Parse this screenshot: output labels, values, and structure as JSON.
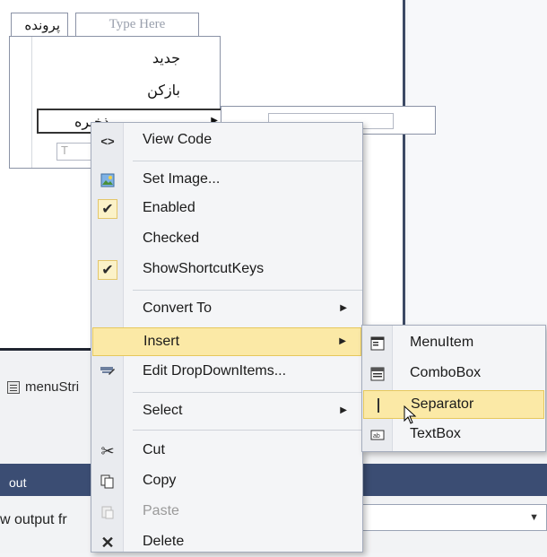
{
  "designer": {
    "menustrip": {
      "file_tab": "پرونده",
      "type_here": "Type Here",
      "dropdown_items": [
        "جدید",
        "بازکن",
        "ذخیره"
      ],
      "type_here_small": "T"
    }
  },
  "tray": {
    "component_label": "menuStri"
  },
  "output": {
    "title": "out",
    "show_output_label": "w output fr"
  },
  "context_menu": {
    "items": [
      {
        "label": "View Code",
        "icon": "view-code-icon"
      },
      {
        "label": "Set Image...",
        "icon": "image-icon"
      },
      {
        "label": "Enabled",
        "icon": "checkmark-icon",
        "checked": true
      },
      {
        "label": "Checked"
      },
      {
        "label": "ShowShortcutKeys",
        "icon": "checkmark-icon",
        "checked": true
      },
      {
        "label": "Convert To",
        "submenu": true
      },
      {
        "label": "Insert",
        "submenu": true,
        "highlighted": true
      },
      {
        "label": "Edit DropDownItems...",
        "icon": "edit-items-icon"
      },
      {
        "label": "Select",
        "submenu": true
      },
      {
        "label": "Cut",
        "icon": "cut-icon"
      },
      {
        "label": "Copy",
        "icon": "copy-icon"
      },
      {
        "label": "Paste",
        "icon": "paste-icon",
        "disabled": true
      },
      {
        "label": "Delete",
        "icon": "delete-icon"
      }
    ]
  },
  "insert_submenu": {
    "items": [
      {
        "label": "MenuItem",
        "icon": "menuitem-icon"
      },
      {
        "label": "ComboBox",
        "icon": "combobox-icon"
      },
      {
        "label": "Separator",
        "icon": "separator-icon",
        "highlighted": true
      },
      {
        "label": "TextBox",
        "icon": "textbox-icon"
      }
    ]
  },
  "colors": {
    "highlight": "#fbe9a6",
    "highlight_border": "#e6c85c",
    "output_bar": "#3b4d73"
  }
}
